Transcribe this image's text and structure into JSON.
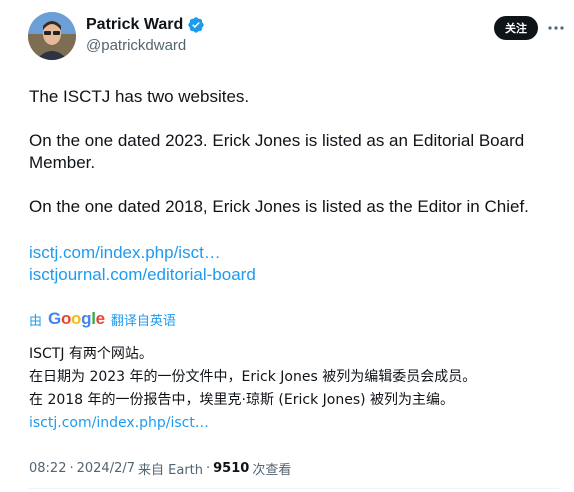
{
  "author": {
    "display_name": "Patrick Ward",
    "handle": "@patrickdward",
    "verified": true
  },
  "follow_label": "关注",
  "tweet": {
    "paragraphs": [
      "The ISCTJ has two websites.",
      "On the one dated 2023. Erick Jones is listed as an Editorial Board Member.",
      "On the one dated 2018, Erick Jones is listed as the Editor in Chief."
    ],
    "links": [
      "isctj.com/index.php/isct…",
      "isctjournal.com/editorial-board"
    ]
  },
  "translation": {
    "by_label": "由",
    "provider": "Google",
    "action_label": "翻译自英语",
    "lines": [
      "ISCTJ 有两个网站。",
      "在日期为 2023 年的一份文件中，Erick Jones 被列为编辑委员会成员。",
      "在 2018 年的一份报告中，埃里克·琼斯 (Erick Jones) 被列为主编。"
    ],
    "link": "isctj.com/index.php/isct…"
  },
  "meta": {
    "time": "08:22",
    "date": "2024/2/7",
    "source": "来自 Earth",
    "views_count": "9510",
    "views_label": "次查看"
  },
  "colors": {
    "link": "#1d9bf0",
    "text": "#0f1419",
    "secondary": "#536471",
    "verified": "#1d9bf0"
  },
  "icons": {
    "verified": "verified-badge-icon",
    "more": "more-dots-icon"
  }
}
